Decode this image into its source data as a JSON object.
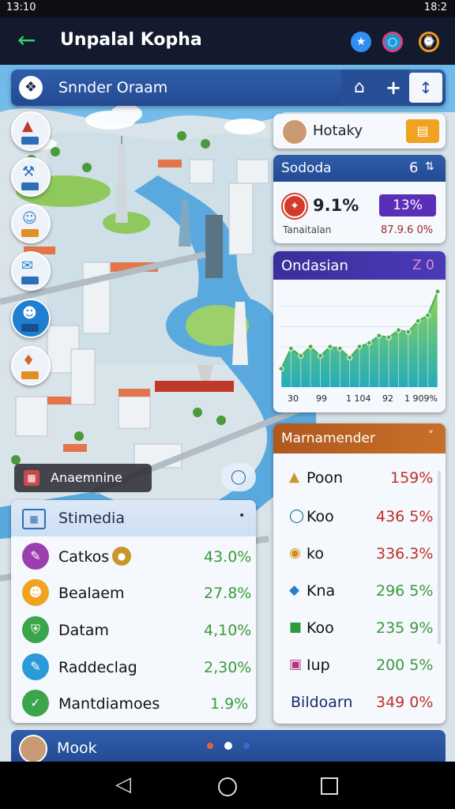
{
  "status": {
    "time": "13:10",
    "right": "18:2"
  },
  "app": {
    "title": "Unpalal Kopha"
  },
  "search": {
    "text": "Snnder Oraam"
  },
  "hotel": {
    "name": "Hotaky"
  },
  "stats": {
    "title": "Sododa",
    "title_right": "6",
    "value": "9.1%",
    "badge": "13%",
    "caption_left": "Tanaitalan",
    "caption_right": "87.9.6 0%"
  },
  "chart_card": {
    "title": "Ondasian",
    "title_right": "Z 0",
    "xticks": [
      "30",
      "99",
      "1 104",
      "92",
      "1 909%"
    ]
  },
  "chart_data": {
    "type": "area",
    "title": "Ondasian",
    "x": [
      1,
      2,
      3,
      4,
      5,
      6,
      7,
      8,
      9,
      10,
      11,
      12,
      13,
      14,
      15,
      16,
      17
    ],
    "values": [
      20,
      42,
      34,
      44,
      34,
      44,
      42,
      32,
      44,
      48,
      56,
      54,
      62,
      60,
      72,
      78,
      104
    ],
    "ylim": [
      0,
      110
    ],
    "grid": true,
    "colors": {
      "line": "#4caf50",
      "fill_top": "#8ad24a",
      "fill_bottom": "#1aa8b6"
    }
  },
  "map_label": {
    "text": "Anaemnine"
  },
  "market": {
    "title": "Marnamender",
    "rows": [
      {
        "icon": "gold-drop-icon",
        "name": "Poon",
        "value": "159%",
        "color": "#c9962a"
      },
      {
        "icon": "ring-icon",
        "name": "Koo",
        "value": "436 5%",
        "color": "#1e6b8c"
      },
      {
        "icon": "orange-coin-icon",
        "name": "ko",
        "value": "336.3%",
        "color": "#d38c14"
      },
      {
        "icon": "crystal-icon",
        "name": "Kna",
        "value": "296 5%",
        "color": "#2a7fc4"
      },
      {
        "icon": "green-block-icon",
        "name": "Koo",
        "value": "235 9%",
        "color": "#2f9a3a"
      },
      {
        "icon": "pink-box-icon",
        "name": "Iup",
        "value": "200 5%",
        "color": "#b2357a"
      },
      {
        "icon": "",
        "name": "Bildoarn",
        "value": "349 0%",
        "color": ""
      }
    ]
  },
  "stimedia": {
    "title": "Stimedia",
    "rows": [
      {
        "icon": "purple-pencil-icon",
        "name": "Catkos",
        "value": "43.0%",
        "color": "#9b3eb0"
      },
      {
        "icon": "orange-user-icon",
        "name": "Bealaem",
        "value": "27.8%",
        "color": "#f0a320"
      },
      {
        "icon": "shield-icon",
        "name": "Datam",
        "value": "4,10%",
        "color": "#3aa54a"
      },
      {
        "icon": "edit-icon",
        "name": "Raddeclag",
        "value": "2,30%",
        "color": "#2a9ad8"
      },
      {
        "icon": "leaf-icon",
        "name": "Mantdiamoes",
        "value": "1.9%",
        "color": "#3aa54a"
      }
    ]
  },
  "bottom": {
    "name": "Mook"
  }
}
